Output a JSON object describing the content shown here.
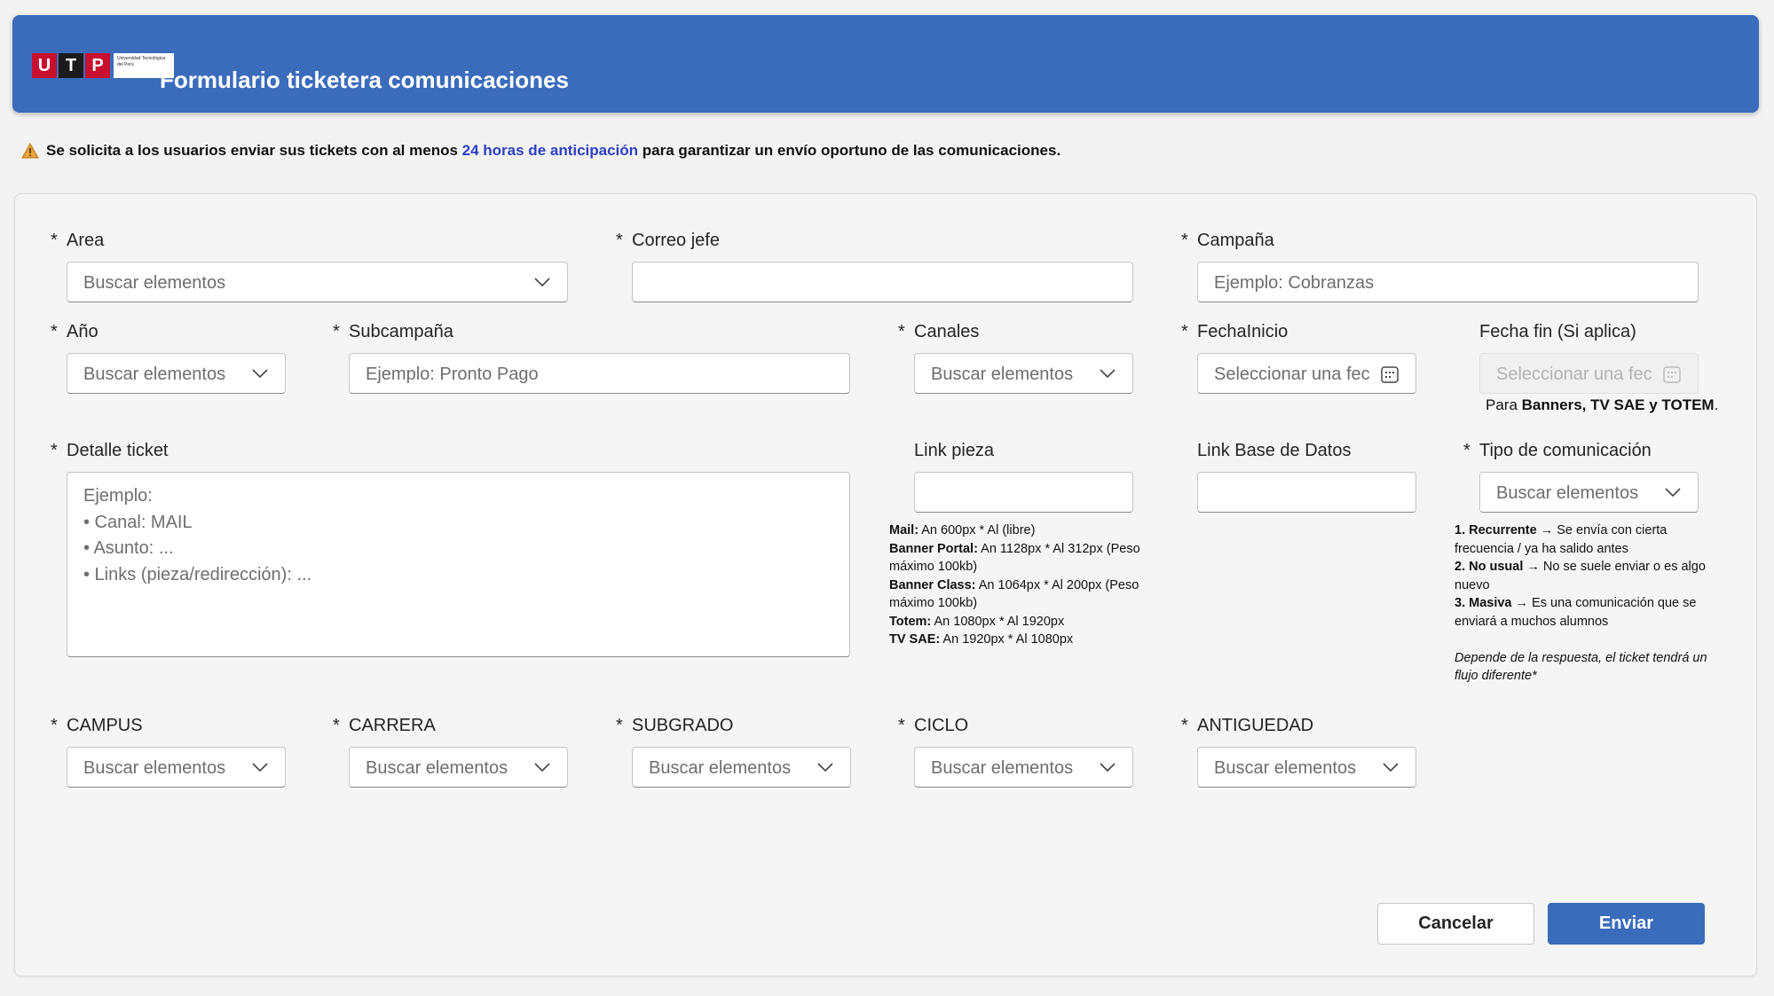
{
  "header": {
    "logo_letters": [
      "U",
      "T",
      "P"
    ],
    "logo_subtext": "Universidad Tecnológica del Perú",
    "title": "Formulario ticketera comunicaciones"
  },
  "notice": {
    "pre": "Se solicita a los usuarios enviar sus tickets con al menos ",
    "highlight": "24 horas de anticipación",
    "post": " para garantizar un envío oportuno de las comunicaciones."
  },
  "required_mark": "*",
  "form": {
    "area": {
      "label": "Area",
      "placeholder": "Buscar elementos"
    },
    "correo_jefe": {
      "label": "Correo jefe",
      "value": ""
    },
    "campana": {
      "label": "Campaña",
      "placeholder": "Ejemplo: Cobranzas"
    },
    "anio": {
      "label": "Año",
      "placeholder": "Buscar elementos"
    },
    "subcampana": {
      "label": "Subcampaña",
      "placeholder": "Ejemplo: Pronto Pago"
    },
    "canales": {
      "label": "Canales",
      "placeholder": "Buscar elementos"
    },
    "fecha_inicio": {
      "label": "FechaInicio",
      "placeholder": "Seleccionar una fec"
    },
    "fecha_fin": {
      "label": "Fecha fin (Si aplica)",
      "placeholder": "Seleccionar una fec",
      "note_pre": "Para ",
      "note_bold": "Banners, TV SAE y TOTEM",
      "note_post": "."
    },
    "detalle": {
      "label": "Detalle ticket",
      "placeholder": "Ejemplo:\n• Canal: MAIL\n• Asunto: ...\n• Links (pieza/redirección): ..."
    },
    "link_pieza": {
      "label": "Link pieza",
      "value": "",
      "specs": [
        {
          "name": "Mail:",
          "text": " An 600px * Al (libre)"
        },
        {
          "name": "Banner Portal:",
          "text": " An 1128px * Al 312px (Peso máximo 100kb)"
        },
        {
          "name": "Banner Class:",
          "text": " An 1064px * Al 200px (Peso máximo 100kb)"
        },
        {
          "name": "Totem:",
          "text": " An 1080px * Al 1920px"
        },
        {
          "name": "TV SAE:",
          "text": " An 1920px * Al 1080px"
        }
      ]
    },
    "link_bd": {
      "label": "Link Base de Datos",
      "value": ""
    },
    "tipo": {
      "label": "Tipo de comunicación",
      "placeholder": "Buscar elementos",
      "options": [
        {
          "name": "1. Recurrente",
          "text": " → Se envía con cierta frecuencia / ya ha salido antes"
        },
        {
          "name": "2. No usual",
          "text": " → No se suele enviar o es algo nuevo"
        },
        {
          "name": "3. Masiva",
          "text": " → Es una comunicación que se enviará a muchos alumnos"
        }
      ],
      "footnote": "Depende de la respuesta, el ticket tendrá un flujo diferente*"
    },
    "campus": {
      "label": "CAMPUS",
      "placeholder": "Buscar elementos"
    },
    "carrera": {
      "label": "CARRERA",
      "placeholder": "Buscar elementos"
    },
    "subgrado": {
      "label": "SUBGRADO",
      "placeholder": "Buscar elementos"
    },
    "ciclo": {
      "label": "CICLO",
      "placeholder": "Buscar elementos"
    },
    "antiguedad": {
      "label": "ANTIGUEDAD",
      "placeholder": "Buscar elementos"
    }
  },
  "buttons": {
    "cancel": "Cancelar",
    "submit": "Enviar"
  },
  "colors": {
    "header_bg": "#3b6cbb",
    "accent_link": "#2d3fc2",
    "logo_red": "#c8102e"
  }
}
